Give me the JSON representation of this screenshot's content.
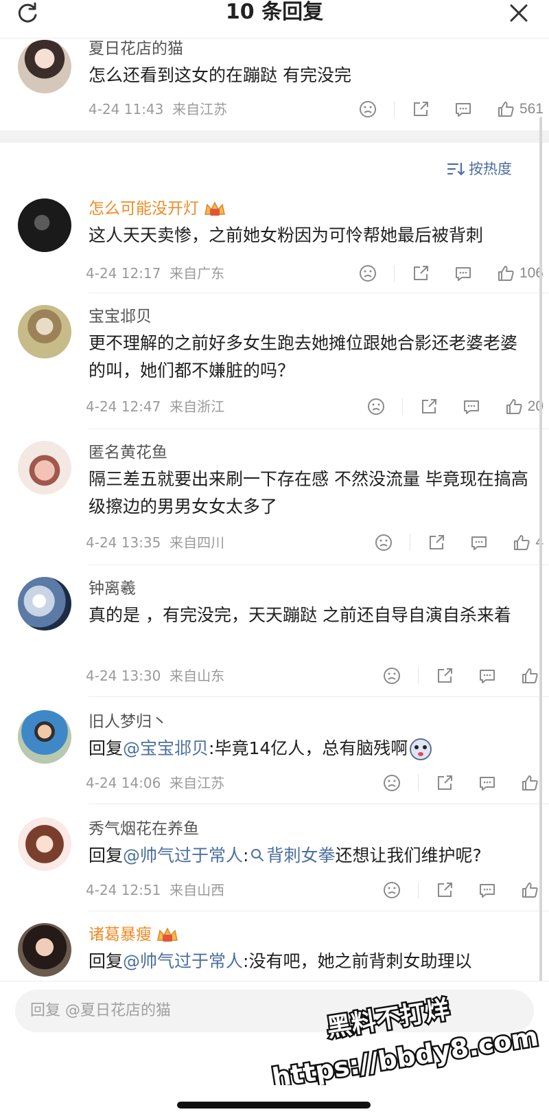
{
  "header": {
    "title": "10 条回复"
  },
  "parent": {
    "name": "夏日花店的猫",
    "text": "怎么还看到这女的在蹦跶 有完没完",
    "date": "4-24 11:43",
    "location": "来自江苏",
    "likes": "561"
  },
  "sort": {
    "label": "按热度"
  },
  "comments": [
    {
      "name": "怎么可能没开灯",
      "text": "这人天天卖惨，之前她女粉因为可怜帮她最后被背刺",
      "date": "4-24 12:17",
      "location": "来自广东",
      "likes": "106"
    },
    {
      "name": "宝宝邶贝",
      "text": "更不理解的之前好多女生跑去她摊位跟她合影还老婆老婆的叫，她们都不嫌脏的吗？",
      "date": "4-24 12:47",
      "location": "来自浙江",
      "likes": "20"
    },
    {
      "name": "匿名黄花鱼",
      "text": "隔三差五就要出来刷一下存在感  不然没流量 毕竟现在搞高级擦边的男男女女太多了",
      "date": "4-24 13:35",
      "location": "来自四川",
      "likes": "4"
    },
    {
      "name": "钟离羲",
      "text": "真的是 ，有完没完，天天蹦跶 之前还自导自演自杀来着",
      "date": "4-24 13:30",
      "location": "来自山东",
      "likes": ""
    },
    {
      "name": "旧人梦归丶",
      "reply_prefix": "回复",
      "mention": "@宝宝邶贝",
      "text": ":毕竟14亿人，总有脑残啊",
      "date": "4-24 14:06",
      "location": "来自江苏",
      "likes": ""
    },
    {
      "name": "秀气烟花在养鱼",
      "reply_prefix": "回复",
      "mention": "@帅气过于常人",
      "topic": "背刺女拳",
      "text": "还想让我们维护呢?",
      "date": "4-24 12:51",
      "location": "来自山西",
      "likes": ""
    },
    {
      "name": "诸葛暴瘦",
      "reply_prefix": "回复",
      "mention": "@帅气过于常人",
      "text": ":没有吧，她之前背刺女助理以"
    }
  ],
  "reply_input": {
    "placeholder": "回复 @夏日花店的猫"
  },
  "watermark": {
    "line1": "黑料不打烊",
    "line2": "https://bbdy8.com"
  },
  "colors": {
    "accent_link": "#4b6f9f",
    "vip_name": "#f08a24",
    "meta": "#9a9a9a"
  }
}
